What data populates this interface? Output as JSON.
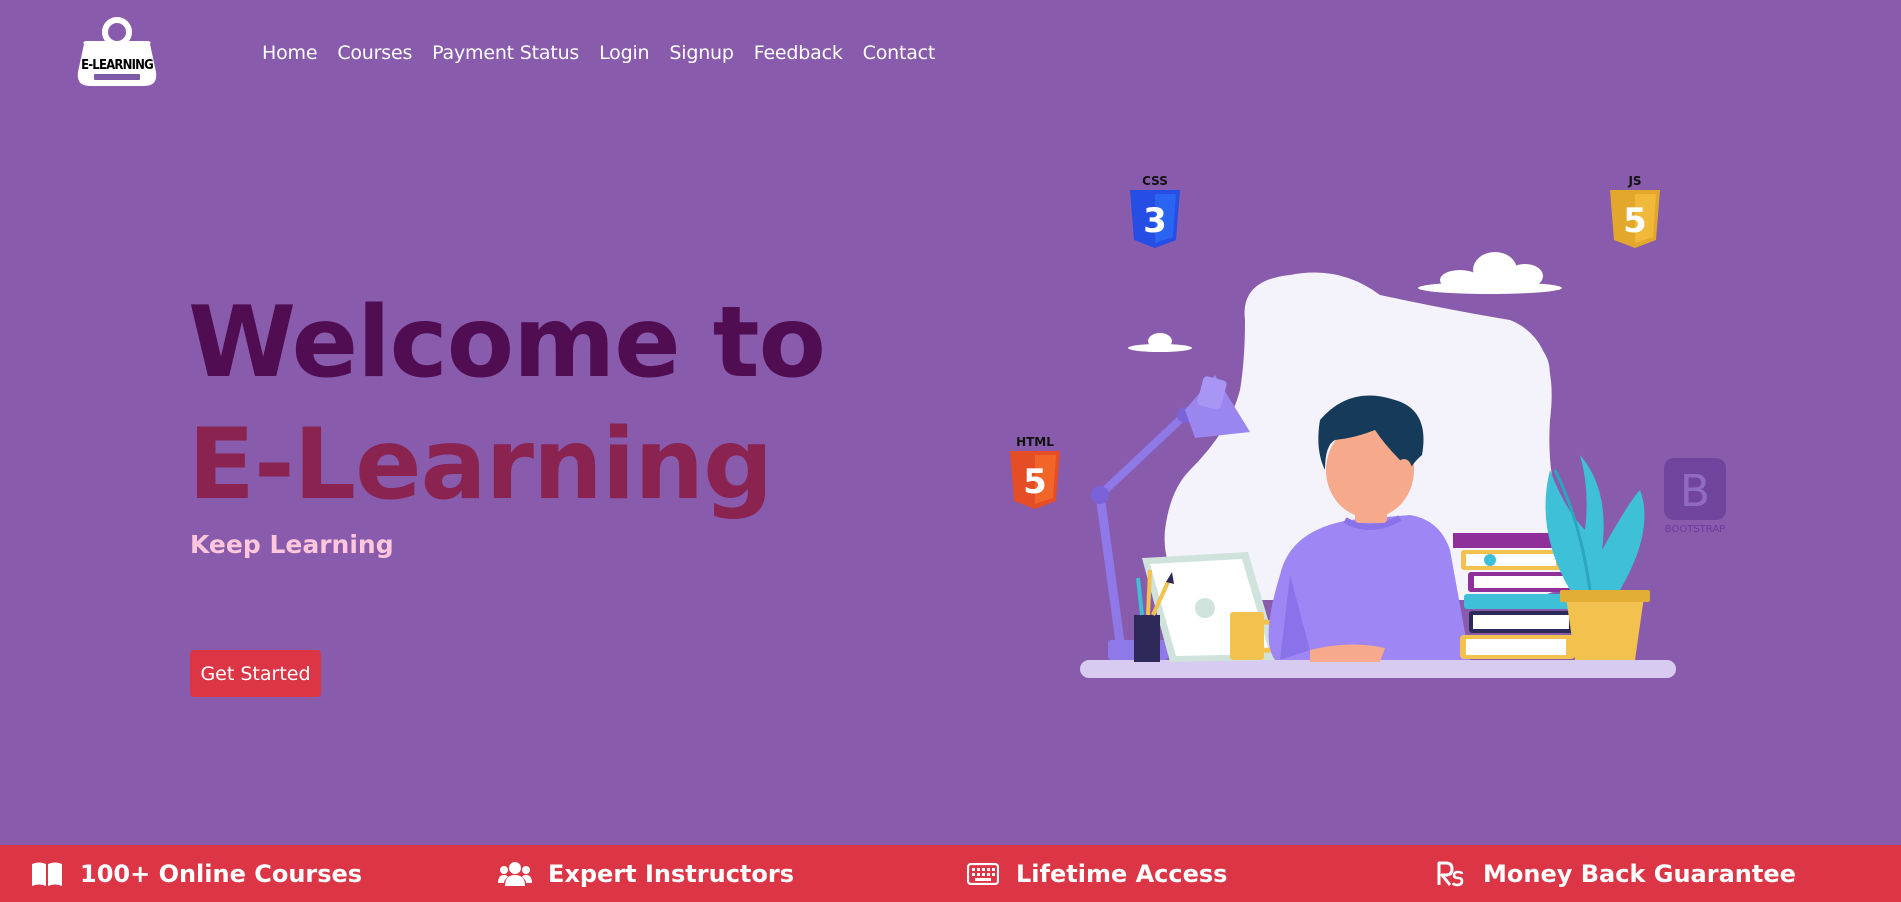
{
  "brand": {
    "logo_text": "E-LEARNING"
  },
  "nav": {
    "items": [
      {
        "label": "Home"
      },
      {
        "label": "Courses"
      },
      {
        "label": "Payment Status"
      },
      {
        "label": "Login"
      },
      {
        "label": "Signup"
      },
      {
        "label": "Feedback"
      },
      {
        "label": "Contact"
      }
    ]
  },
  "hero": {
    "title_line1": "Welcome to",
    "title_line2": "E-Learning",
    "subtitle": "Keep Learning",
    "cta_label": "Get Started"
  },
  "illustration": {
    "badges": {
      "css": "CSS",
      "js": "JS",
      "html": "HTML",
      "bootstrap": "BOOTSTRAP",
      "bootstrap_letter": "B",
      "css_glyph": "3",
      "js_glyph": "5",
      "html_glyph": "5"
    }
  },
  "features": [
    {
      "icon": "book-icon",
      "label": "100+ Online Courses"
    },
    {
      "icon": "users-icon",
      "label": "Expert Instructors"
    },
    {
      "icon": "keyboard-icon",
      "label": "Lifetime Access"
    },
    {
      "icon": "rupee-icon",
      "label": "Money Back Guarantee"
    }
  ],
  "colors": {
    "background": "#885bad",
    "accent_red": "#dc3545",
    "title_dark": "#510d51",
    "title_maroon": "#8a2350",
    "subtitle_pink": "#ffc6dc"
  }
}
